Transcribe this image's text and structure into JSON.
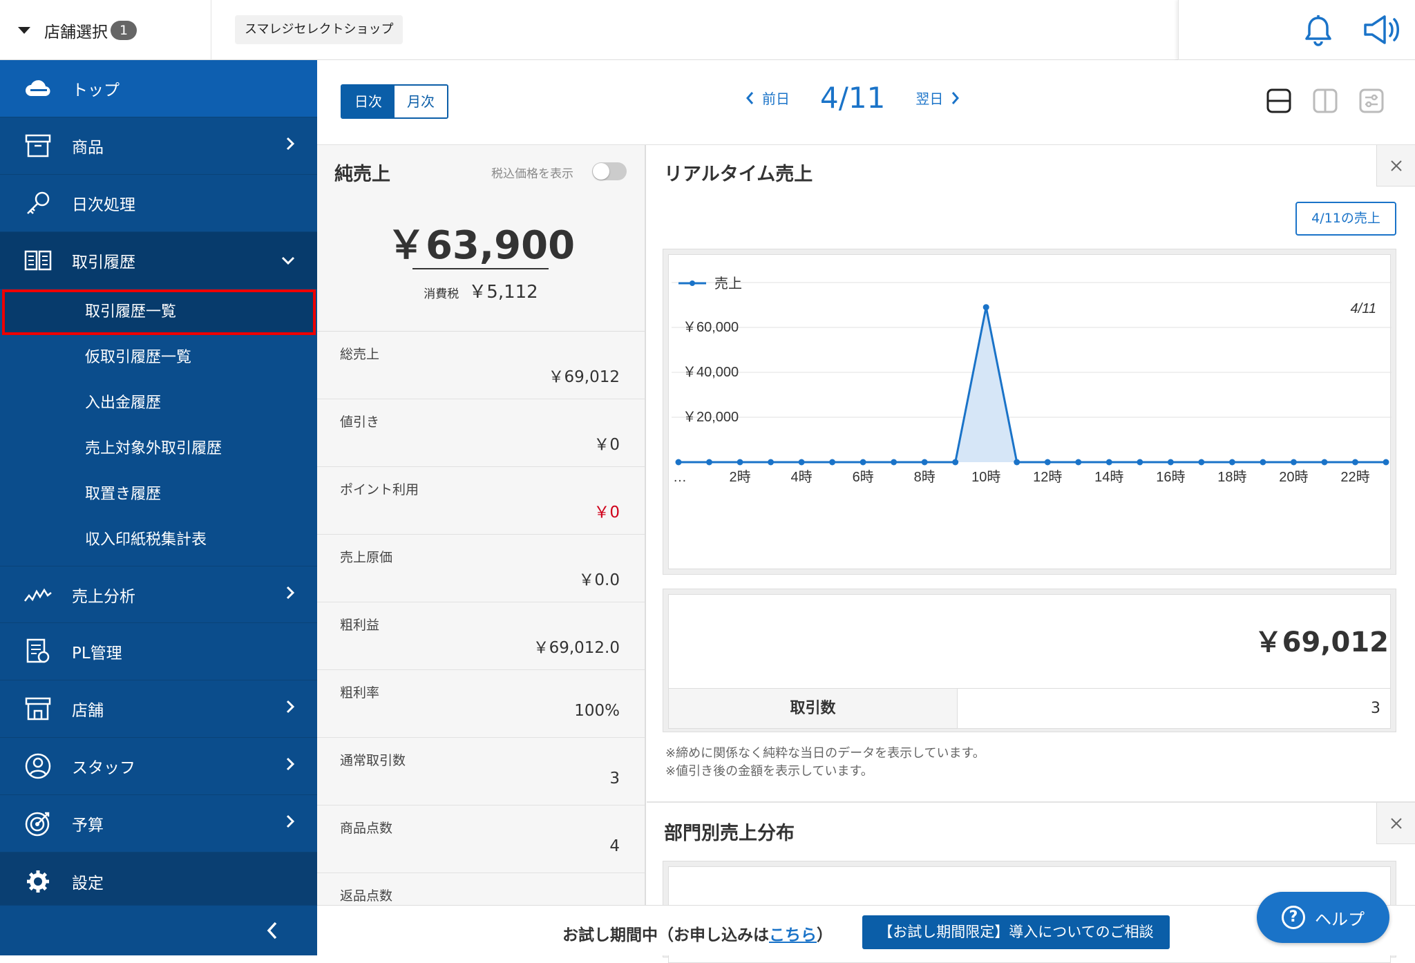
{
  "header": {
    "store_select_label": "店舗選択",
    "store_count": "1",
    "shop_name": "スマレジセレクトショップ"
  },
  "sidebar": {
    "items": [
      {
        "label": "トップ",
        "icon": "cloud-icon"
      },
      {
        "label": "商品",
        "icon": "box-icon"
      },
      {
        "label": "日次処理",
        "icon": "key-icon"
      },
      {
        "label": "取引履歴",
        "icon": "book-icon"
      },
      {
        "label": "売上分析",
        "icon": "trend-icon"
      },
      {
        "label": "PL管理",
        "icon": "report-icon"
      },
      {
        "label": "店舗",
        "icon": "store-icon"
      },
      {
        "label": "スタッフ",
        "icon": "staff-icon"
      },
      {
        "label": "予算",
        "icon": "target-icon"
      },
      {
        "label": "設定",
        "icon": "gear-icon"
      }
    ],
    "sub_items": [
      "取引履歴一覧",
      "仮取引履歴一覧",
      "入出金履歴",
      "売上対象外取引履歴",
      "取置き履歴",
      "収入印紙税集計表"
    ]
  },
  "toolbar": {
    "daily": "日次",
    "monthly": "月次",
    "prev": "前日",
    "date": "4/11",
    "next": "翌日"
  },
  "net_sales": {
    "title": "純売上",
    "toggle_label": "税込価格を表示",
    "amount": "￥63,900",
    "tax_label": "消費税",
    "tax_value": "￥5,112",
    "metrics": [
      {
        "label": "総売上",
        "value": "￥69,012"
      },
      {
        "label": "値引き",
        "value": "￥0"
      },
      {
        "label": "ポイント利用",
        "value": "￥0"
      },
      {
        "label": "売上原価",
        "value": "￥0.0"
      },
      {
        "label": "粗利益",
        "value": "￥69,012.0"
      },
      {
        "label": "粗利率",
        "value": "100%"
      },
      {
        "label": "通常取引数",
        "value": "3"
      },
      {
        "label": "商品点数",
        "value": "4"
      },
      {
        "label": "返品点数",
        "value": ""
      }
    ]
  },
  "realtime": {
    "title": "リアルタイム売上",
    "date_sales_button": "4/11の売上",
    "total": "￥69,012",
    "tx_label": "取引数",
    "tx_value": "3",
    "notes": [
      "※締めに関係なく純粋な当日のデータを表示しています。",
      "※値引き後の金額を表示しています。"
    ]
  },
  "dept": {
    "title": "部門別売上分布"
  },
  "footer": {
    "trial_text": "お試し期間中（お申し込みは",
    "trial_link": "こちら",
    "trial_close": "）",
    "consult": "【お試し期間限定】導入についてのご相談"
  },
  "help": {
    "label": "ヘルプ"
  },
  "chart_data": {
    "type": "area",
    "legend": "売上",
    "legend_position": "top-left",
    "date_label": "4/11",
    "x": [
      "0時",
      "1時",
      "2時",
      "3時",
      "4時",
      "5時",
      "6時",
      "7時",
      "8時",
      "9時",
      "10時",
      "11時",
      "12時",
      "13時",
      "14時",
      "15時",
      "16時",
      "17時",
      "18時",
      "19時",
      "20時",
      "21時",
      "22時",
      "23時"
    ],
    "tick_labels": [
      "…",
      "2時",
      "4時",
      "6時",
      "8時",
      "10時",
      "12時",
      "14時",
      "16時",
      "18時",
      "20時",
      "22時"
    ],
    "series": [
      {
        "name": "売上",
        "values": [
          0,
          0,
          0,
          0,
          0,
          0,
          0,
          0,
          0,
          0,
          69012,
          0,
          0,
          0,
          0,
          0,
          0,
          0,
          0,
          0,
          0,
          0,
          0,
          0
        ]
      }
    ],
    "y_ticks": [
      "￥20,000",
      "￥40,000",
      "￥60,000"
    ],
    "ylim": [
      0,
      80000
    ],
    "grid": true,
    "colors": {
      "line": "#1a73c8",
      "fill": "#d6e6f7"
    }
  }
}
